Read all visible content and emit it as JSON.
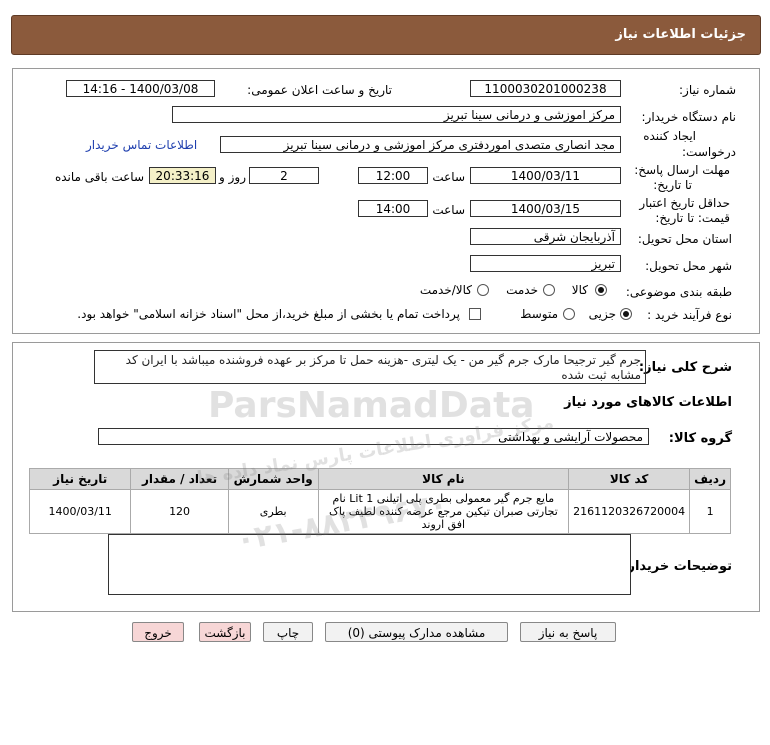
{
  "header": {
    "title": "جزئیات اطلاعات نیاز"
  },
  "form": {
    "need_number_label": "شماره نیاز:",
    "need_number": "1100030201000238",
    "announce_label": "تاریخ و ساعت اعلان عمومی:",
    "announce_value": "1400/03/08 - 14:16",
    "buyer_org_label": "نام دستگاه خریدار:",
    "buyer_org": "مرکز اموزشی و درمانی سینا تبریز",
    "requester_label_1": "ایجاد کننده",
    "requester_label_2": "درخواست:",
    "requester": "مجد انصاری متصدی اموردفتری مرکز اموزشی و درمانی سینا تبریز",
    "contact_link": "اطلاعات تماس خریدار",
    "deadline_label_1": "مهلت ارسال پاسخ:",
    "deadline_label_2": "تا تاریخ:",
    "deadline_date": "1400/03/11",
    "time_label": "ساعت",
    "deadline_time": "12:00",
    "days_value": "2",
    "days_label": "روز و",
    "remaining_time": "20:33:16",
    "remaining_label": "ساعت باقی مانده",
    "validity_label_1": "حداقل تاریخ اعتبار",
    "validity_label_2": "قیمت: تا تاریخ:",
    "validity_date": "1400/03/15",
    "validity_time": "14:00",
    "province_label": "استان محل تحویل:",
    "province": "آذربایجان شرقی",
    "city_label": "شهر محل تحویل:",
    "city": "تبریز",
    "category_label": "طبقه بندی موضوعی:",
    "category_options": [
      "کالا",
      "خدمت",
      "کالا/خدمت"
    ],
    "category_selected": "کالا",
    "process_label": "نوع فرآیند خرید :",
    "process_options": [
      "جزیی",
      "متوسط"
    ],
    "process_selected": "جزیی",
    "payment_note": "پرداخت تمام یا بخشی از مبلغ خرید،از محل \"اسناد خزانه اسلامی\" خواهد بود."
  },
  "description": {
    "label": "شرح کلی نیاز:",
    "text": "جرم گیر ترجیحا مارک  جرم گیر من - یک لیتری -هزینه حمل تا مرکز بر عهده فروشنده میباشد با ایران کد مشابه ثبت شده"
  },
  "goods": {
    "section_title": "اطلاعات کالاهای مورد نیاز",
    "group_label": "گروه کالا:",
    "group_value": "محصولات آرایشی و بهداشتی",
    "columns": [
      "ردیف",
      "کد کالا",
      "نام کالا",
      "واحد شمارش",
      "تعداد / مقدار",
      "تاریخ نیاز"
    ],
    "rows": [
      {
        "row": "1",
        "code": "2161120326720004",
        "name": "مایع جرم گیر معمولی بطری پلی اتیلنی 1 Lit نام تجارتی صبران تیکین مرجع عرضه کننده لطیف پاک افق اروند",
        "unit": "بطری",
        "qty": "120",
        "date": "1400/03/11"
      }
    ]
  },
  "buyer_notes": {
    "label": "توضیحات خریدار:",
    "value": ""
  },
  "buttons": {
    "reply": "پاسخ به نیاز",
    "view_docs": "مشاهده مدارک پیوستی (0)",
    "print": "چاپ",
    "back": "بازگشت",
    "exit": "خروج"
  },
  "watermark": {
    "brand": "ParsNamadData",
    "sub": "مرکز فراوری اطلاعات پارس نماد داده ها",
    "phone": "۰۲۱-۸۸۳۴۹۶۷۰"
  }
}
